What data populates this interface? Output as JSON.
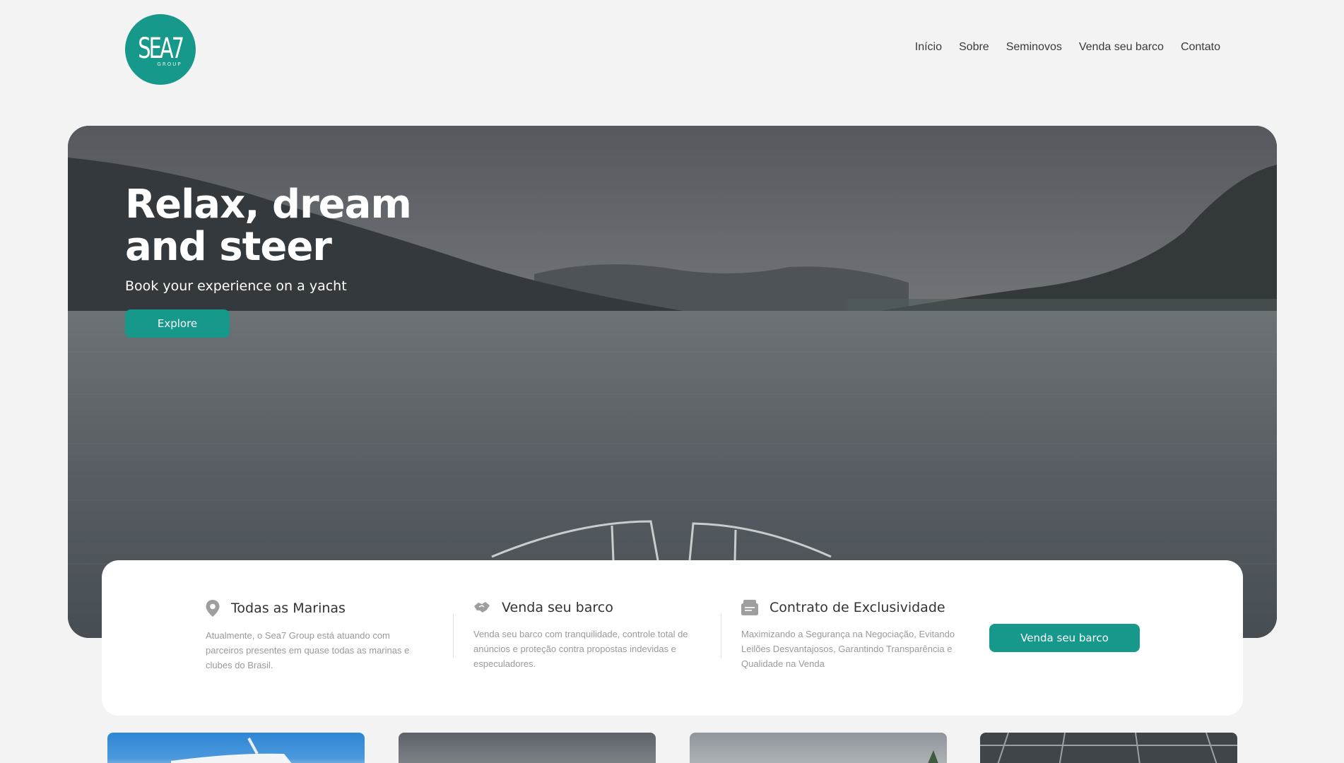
{
  "brand": {
    "logo_text": "SEA7",
    "logo_sub": "GROUP",
    "accent": "#16988a"
  },
  "nav": {
    "items": [
      "Início",
      "Sobre",
      "Seminovos",
      "Venda seu barco",
      "Contato"
    ]
  },
  "hero": {
    "title": "Relax, dream and steer",
    "subtitle": "Book your experience on a yacht",
    "button": "Explore"
  },
  "features": [
    {
      "icon": "map-pin-icon",
      "title": "Todas as Marinas",
      "description": "Atualmente, o Sea7 Group está atuando com parceiros presentes em quase todas as marinas e clubes do Brasil."
    },
    {
      "icon": "handshake-icon",
      "title": "Venda seu barco",
      "description": "Venda seu barco com tranquilidade, controle total de anúncios e proteção contra propostas indevidas e especuladores."
    },
    {
      "icon": "contract-icon",
      "title": "Contrato de Exclusividade",
      "description": "Maximizando a Segurança na Negociação, Evitando Leilões Desvantajosos, Garantindo Transparência e Qualidade na Venda"
    }
  ],
  "cta": {
    "button": "Venda seu barco"
  }
}
